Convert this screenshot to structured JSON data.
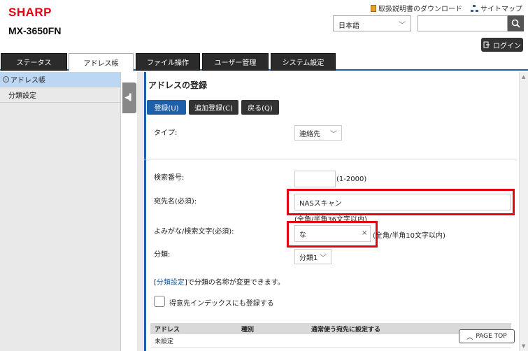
{
  "header": {
    "brand": "SHARP",
    "model": "MX-3650FN",
    "links": {
      "manual": "取扱説明書のダウンロード",
      "sitemap": "サイトマップ"
    },
    "language": "日本語",
    "search_value": "",
    "login_label": "ログイン"
  },
  "tabs": [
    {
      "label": "ステータス",
      "active": false
    },
    {
      "label": "アドレス帳",
      "active": true
    },
    {
      "label": "ファイル操作",
      "active": false
    },
    {
      "label": "ユーザー管理",
      "active": false
    },
    {
      "label": "システム設定",
      "active": false
    }
  ],
  "sidebar": {
    "items": [
      {
        "label": "アドレス帳",
        "active": true
      },
      {
        "label": "分類設定",
        "active": false
      }
    ]
  },
  "main": {
    "title": "アドレスの登録",
    "buttons": {
      "register": "登録(U)",
      "add_register": "追加登録(C)",
      "back": "戻る(Q)"
    },
    "form": {
      "type_label": "タイプ:",
      "type_value": "連絡先",
      "search_no_label": "検索番号:",
      "search_no_value": "",
      "search_no_hint": "(1-2000)",
      "name_label": "宛先名(必須):",
      "name_value": "NASスキャン",
      "name_hint": "(全角/半角36文字以内)",
      "reading_label": "よみがな/検索文字(必須):",
      "reading_value": "な",
      "reading_hint": "(全角/半角10文字以内)",
      "category_label": "分類:",
      "category_value": "分類1",
      "category_link": "分類設定",
      "category_note_prefix": "[",
      "category_note_suffix": "]で分類の名称が変更できます。",
      "index_checkbox_label": "得意先インデックスにも登録する",
      "index_checked": false
    },
    "table": {
      "headers": [
        "アドレス",
        "種別",
        "通常使う宛先に設定する"
      ],
      "rows": [
        [
          "未設定",
          "",
          ""
        ]
      ]
    },
    "pagetop_label": "PAGE TOP"
  },
  "colors": {
    "brand_red": "#e60012",
    "accent_blue": "#1d5fa8",
    "highlight_red": "#e60012"
  }
}
